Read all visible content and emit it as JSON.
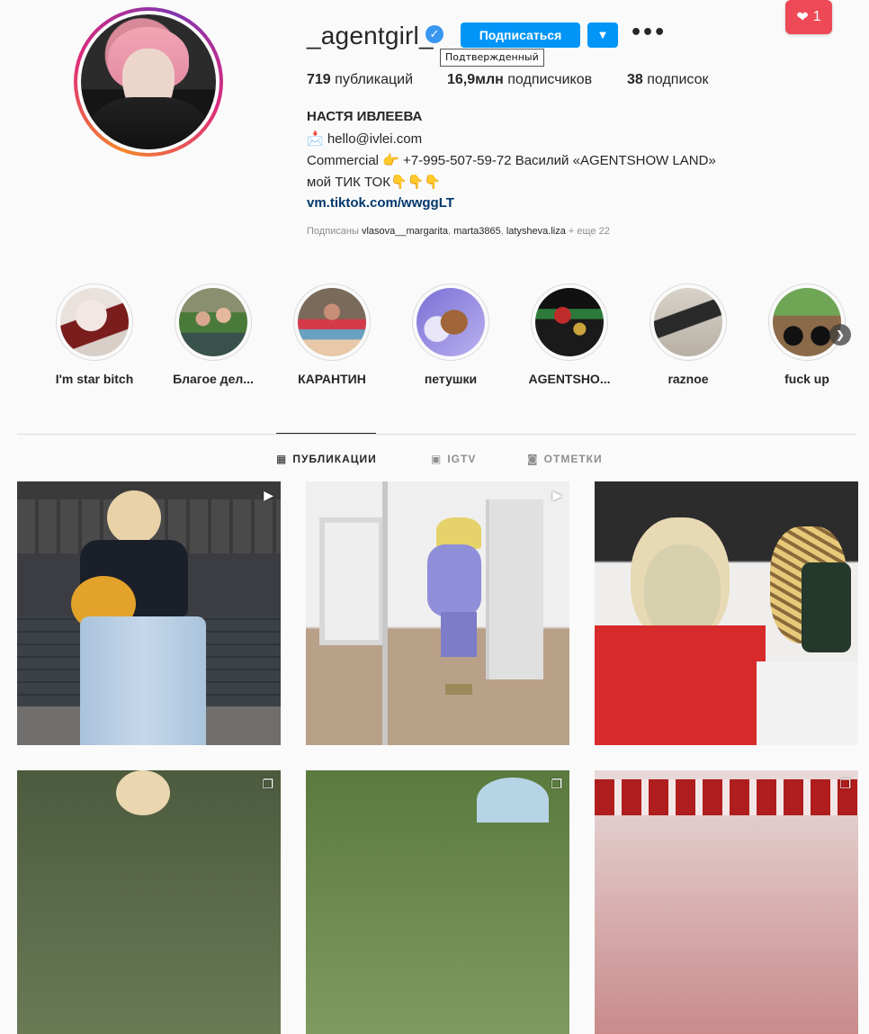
{
  "profile": {
    "username": "_agentgirl_",
    "verified_icon": "check-icon",
    "verified_tooltip": "Подтвержденный",
    "follow_label": "Подписаться",
    "dropdown_icon": "▼",
    "more_icon": "•••"
  },
  "notification": {
    "icon": "heart-icon",
    "count": "1",
    "color": "#ed4956"
  },
  "stats": {
    "posts_count": "719",
    "posts_label": "публикаций",
    "followers_count": "16,9млн",
    "followers_label": "подписчиков",
    "following_count": "38",
    "following_label": "подписок"
  },
  "bio": {
    "name": "НАСТЯ ИВЛЕЕВА",
    "line1": "📩 hello@ivlei.com",
    "line2": "Commercial 👉 +7-995-507-59-72 Василий «AGENTSHOW LAND»",
    "line3": "мой ТИК ТОК👇👇👇",
    "link": "vm.tiktok.com/wwggLT"
  },
  "followed_by": {
    "prefix": "Подписаны",
    "users": [
      "vlasova__margarita",
      "marta3865",
      "latysheva.liza"
    ],
    "suffix": "+ еще 22"
  },
  "highlights": [
    {
      "label": "I'm star bitch"
    },
    {
      "label": "Благое дел..."
    },
    {
      "label": "КАРАНТИН"
    },
    {
      "label": "петушки"
    },
    {
      "label": "AGENTSHO..."
    },
    {
      "label": "raznoe"
    },
    {
      "label": "fuck up"
    }
  ],
  "tabs": [
    {
      "label": "ПУБЛИКАЦИИ",
      "icon": "grid-icon",
      "active": true
    },
    {
      "label": "IGTV",
      "icon": "igtv-icon",
      "active": false
    },
    {
      "label": "ОТМЕТКИ",
      "icon": "tagged-icon",
      "active": false
    }
  ],
  "posts": [
    {
      "type": "video"
    },
    {
      "type": "video"
    },
    {
      "type": "image"
    },
    {
      "type": "carousel"
    },
    {
      "type": "carousel"
    },
    {
      "type": "carousel"
    }
  ],
  "colors": {
    "accent": "#0095f6",
    "link": "#00376b",
    "muted": "#8e8e8e",
    "text": "#262626",
    "border": "#dbdbdb"
  }
}
